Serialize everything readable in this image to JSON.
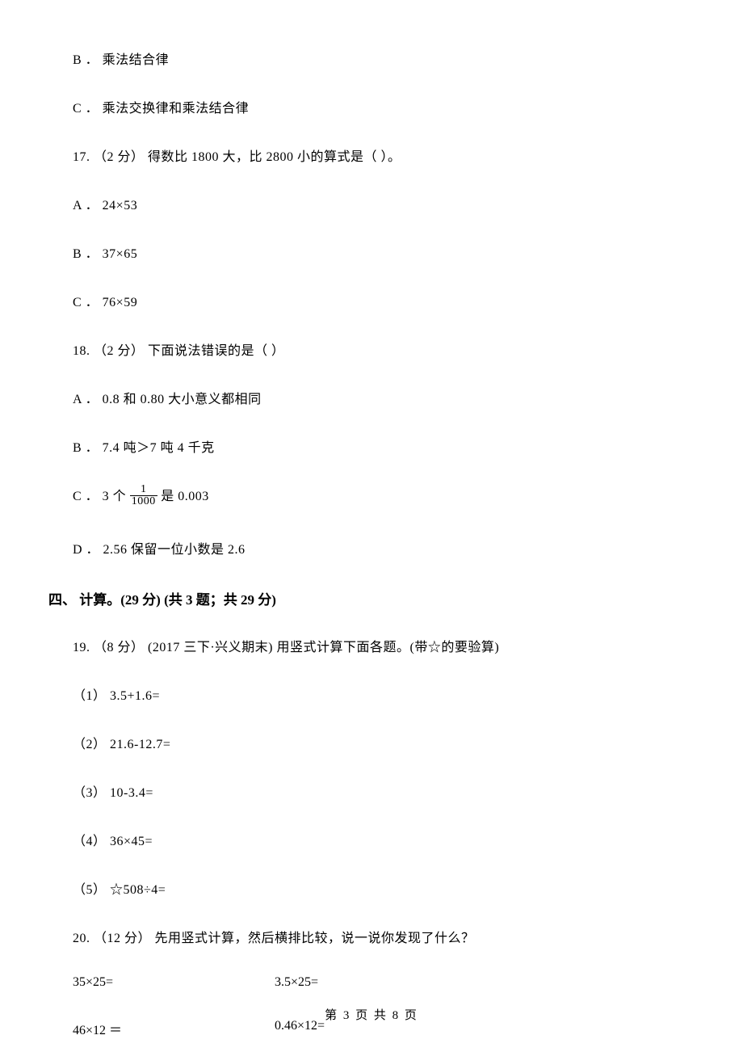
{
  "options": {
    "b_top": "B ． 乘法结合律",
    "c_top": "C ． 乘法交换律和乘法结合律"
  },
  "q17": {
    "stem": "17. （2 分） 得数比 1800 大，比 2800 小的算式是（    ）。",
    "a": "A ． 24×53",
    "b": "B ． 37×65",
    "c": "C ． 76×59"
  },
  "q18": {
    "stem": "18. （2 分） 下面说法错误的是（    ）",
    "a": "A ． 0.8 和 0.80 大小意义都相同",
    "b": "B ． 7.4 吨＞7 吨 4 千克",
    "c_pre": "C ． 3 个 ",
    "c_post": " 是 0.003",
    "c_num": "1",
    "c_den": "1000",
    "d": "D ． 2.56 保留一位小数是 2.6"
  },
  "section4": "四、 计算。(29 分) (共 3 题；共 29 分)",
  "q19": {
    "stem": "19. （8 分） (2017 三下·兴义期末) 用竖式计算下面各题。(带☆的要验算)",
    "s1": "（1） 3.5+1.6=",
    "s2": "（2） 21.6-12.7=",
    "s3": "（3） 10-3.4=",
    "s4": "（4） 36×45=",
    "s5": "（5） ☆508÷4="
  },
  "q20": {
    "stem": "20. （12 分） 先用竖式计算，然后横排比较，说一说你发现了什么？",
    "r1a": "35×25=",
    "r1b": "3.5×25=",
    "r2a": "46×12 ＝",
    "r2b": "0.46×12="
  },
  "footer": "第 3 页 共 8 页"
}
